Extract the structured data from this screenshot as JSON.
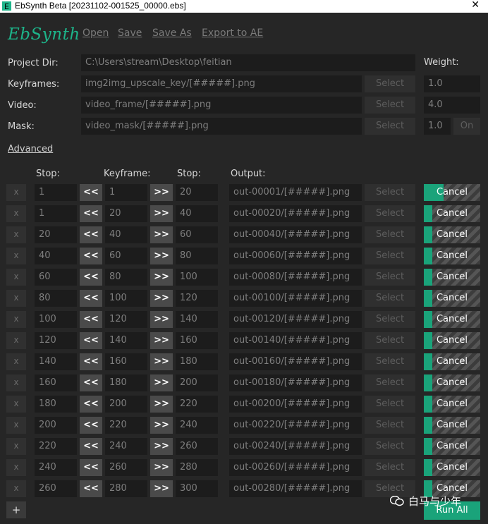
{
  "window": {
    "title": "EbSynth Beta [20231102-001525_00000.ebs]"
  },
  "app": {
    "logo_text": "EbSynth"
  },
  "menu": {
    "open": "Open",
    "save": "Save",
    "save_as": "Save As",
    "export": "Export to AE"
  },
  "project": {
    "project_dir_label": "Project Dir:",
    "project_dir_value": "C:\\Users\\stream\\Desktop\\feitian",
    "keyframes_label": "Keyframes:",
    "keyframes_value": "img2img_upscale_key/[#####].png",
    "video_label": "Video:",
    "video_value": "video_frame/[#####].png",
    "mask_label": "Mask:",
    "mask_value": "video_mask/[#####].png",
    "select_label": "Select",
    "weight_label": "Weight:",
    "keyframes_weight": "1.0",
    "video_weight": "4.0",
    "mask_weight": "1.0",
    "mask_toggle": "On"
  },
  "advanced_label": "Advanced",
  "columns": {
    "stop1": "Stop:",
    "keyframe": "Keyframe:",
    "stop2": "Stop:",
    "output": "Output:"
  },
  "row_labels": {
    "remove": "x",
    "prev": "<<",
    "next": ">>",
    "select": "Select",
    "cancel": "Cancel"
  },
  "rows": [
    {
      "stop_start": "1",
      "keyframe": "1",
      "stop_end": "20",
      "output": "out-00001/[#####].png",
      "progress": 0.35
    },
    {
      "stop_start": "1",
      "keyframe": "20",
      "stop_end": "40",
      "output": "out-00020/[#####].png",
      "progress": 0.15
    },
    {
      "stop_start": "20",
      "keyframe": "40",
      "stop_end": "60",
      "output": "out-00040/[#####].png",
      "progress": 0.15
    },
    {
      "stop_start": "40",
      "keyframe": "60",
      "stop_end": "80",
      "output": "out-00060/[#####].png",
      "progress": 0.15
    },
    {
      "stop_start": "60",
      "keyframe": "80",
      "stop_end": "100",
      "output": "out-00080/[#####].png",
      "progress": 0.15
    },
    {
      "stop_start": "80",
      "keyframe": "100",
      "stop_end": "120",
      "output": "out-00100/[#####].png",
      "progress": 0.15
    },
    {
      "stop_start": "100",
      "keyframe": "120",
      "stop_end": "140",
      "output": "out-00120/[#####].png",
      "progress": 0.15
    },
    {
      "stop_start": "120",
      "keyframe": "140",
      "stop_end": "160",
      "output": "out-00140/[#####].png",
      "progress": 0.15
    },
    {
      "stop_start": "140",
      "keyframe": "160",
      "stop_end": "180",
      "output": "out-00160/[#####].png",
      "progress": 0.15
    },
    {
      "stop_start": "160",
      "keyframe": "180",
      "stop_end": "200",
      "output": "out-00180/[#####].png",
      "progress": 0.15
    },
    {
      "stop_start": "180",
      "keyframe": "200",
      "stop_end": "220",
      "output": "out-00200/[#####].png",
      "progress": 0.15
    },
    {
      "stop_start": "200",
      "keyframe": "220",
      "stop_end": "240",
      "output": "out-00220/[#####].png",
      "progress": 0.15
    },
    {
      "stop_start": "220",
      "keyframe": "240",
      "stop_end": "260",
      "output": "out-00240/[#####].png",
      "progress": 0.15
    },
    {
      "stop_start": "240",
      "keyframe": "260",
      "stop_end": "280",
      "output": "out-00260/[#####].png",
      "progress": 0.15
    },
    {
      "stop_start": "260",
      "keyframe": "280",
      "stop_end": "300",
      "output": "out-00280/[#####].png",
      "progress": 0.15
    }
  ],
  "add_label": "+",
  "run_all_label": "Run All",
  "watermark_text": "白马与少年",
  "colors": {
    "accent": "#1aa37a",
    "background": "#262626",
    "field": "#1c1c1c"
  }
}
